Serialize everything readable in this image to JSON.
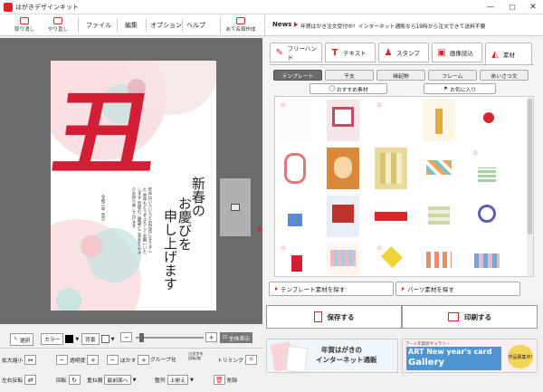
{
  "window": {
    "title": "はがきデザインキット",
    "minimize": "—",
    "maximize": "☐",
    "close": "✕"
  },
  "toolbar": {
    "undo_label": "取り消し",
    "redo_label": "やり直し",
    "menus": [
      "ファイル",
      "編集",
      "オプション",
      "ヘルプ"
    ],
    "address_label": "あて名面作成"
  },
  "news": {
    "label": "News",
    "text": "年賀はがき注文受付中！インターネット通販なら19時から注文できて送料不要"
  },
  "card": {
    "kanji": "丑",
    "greeting_line1": "新春の",
    "greeting_line2": "お慶びを",
    "greeting_line3": "申し上げます",
    "message": "昨年はいろいろとお世話になりました 本年もどうぞよろしくお願いいたします 皆様のご健康とご多幸を心よりお祈り申し上げます",
    "date": "令和三年 元旦"
  },
  "right_tabs": [
    {
      "label": "フリーハンド",
      "icon": "pencil-icon"
    },
    {
      "label": "テキスト",
      "icon": "text-icon"
    },
    {
      "label": "スタンプ",
      "icon": "stamp-icon"
    },
    {
      "label": "画像読込",
      "icon": "image-icon"
    },
    {
      "label": "素材",
      "icon": "shapes-icon"
    }
  ],
  "subtabs": [
    "テンプレート",
    "干支",
    "縁起物",
    "フレーム",
    "あいさつ文"
  ],
  "subtabs2": [
    "おすすめ素材",
    "お気に入り"
  ],
  "find_template": "テンプレート素材を探す",
  "find_parts": "パーツ素材を探す",
  "save": "保存する",
  "print": "印刷する",
  "bottom": {
    "select": "選択",
    "color": "カラー",
    "bg": "背景",
    "fullview": "全体表示",
    "enlarge": "拡大縮小",
    "transparency": "透明度",
    "blur": "ぼかす",
    "group": "グループ化",
    "group_sub": "ロック\nおよび",
    "trimming": "トリミング",
    "flip": "左右反転",
    "rotate": "回転",
    "order": "重ね順",
    "order_val": "最前面へ",
    "align": "整列",
    "align_val": "上揃え",
    "delete": "削除",
    "mini_label": "小文字を\n回転/縦"
  },
  "banner1": {
    "line1": "年賀はがきの",
    "line2": "インターネット通販"
  },
  "banner2": {
    "small": "アート年賀状ギャラリー",
    "title1": "ART New year's card",
    "title2": "Gallery",
    "badge": "作品募集中!"
  },
  "colors": {
    "accent": "#d9262c",
    "canvas": "#6b6b6b"
  }
}
